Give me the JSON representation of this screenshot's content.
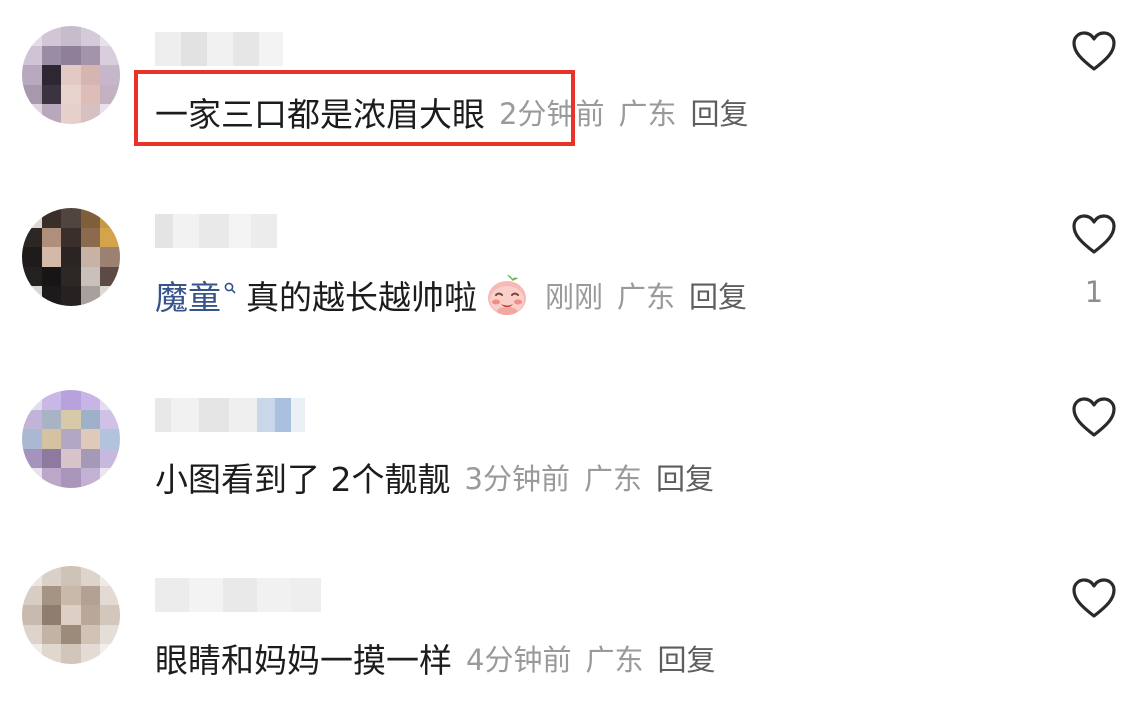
{
  "comments": [
    {
      "text": "一家三口都是浓眉大眼",
      "time": "2分钟前",
      "location": "广东",
      "reply_label": "回复",
      "like_count": ""
    },
    {
      "mention": "魔童",
      "text": "真的越长越帅啦",
      "time": "刚刚",
      "location": "广东",
      "reply_label": "回复",
      "like_count": "1"
    },
    {
      "text": "小图看到了 2个靓靓",
      "time": "3分钟前",
      "location": "广东",
      "reply_label": "回复",
      "like_count": ""
    },
    {
      "text": "眼睛和妈妈一摸一样",
      "time": "4分钟前",
      "location": "广东",
      "reply_label": "回复",
      "like_count": ""
    }
  ],
  "colors": {
    "highlight": "#e8322a",
    "mention": "#36538a",
    "meta": "#9a9a9a"
  },
  "icons": [
    "heart-outline-icon",
    "smiling-face-emoji-icon",
    "search-mention-icon"
  ]
}
